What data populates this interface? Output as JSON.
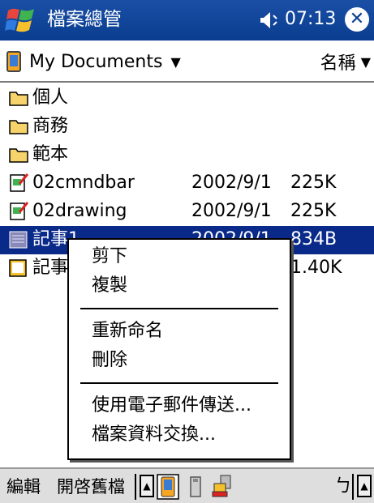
{
  "titlebar": {
    "start_icon": "windows-flag-icon",
    "title": "檔案總管",
    "speaker_icon": "speaker-icon",
    "time": "07:13",
    "close_icon": "close-icon",
    "close_glyph": "✕"
  },
  "location": {
    "folder": "My Documents",
    "sort": "名稱"
  },
  "files": [
    {
      "name": "個人",
      "type": "folder",
      "date": "",
      "size": ""
    },
    {
      "name": "商務",
      "type": "folder",
      "date": "",
      "size": ""
    },
    {
      "name": "範本",
      "type": "folder",
      "date": "",
      "size": ""
    },
    {
      "name": "02cmndbar",
      "type": "doc",
      "date": "2002/9/1",
      "size": "225K"
    },
    {
      "name": "02drawing",
      "type": "doc",
      "date": "2002/9/1",
      "size": "225K"
    },
    {
      "name": "記事1",
      "type": "note",
      "date": "2002/9/1",
      "size": "834B",
      "selected": true
    },
    {
      "name": "記事",
      "type": "note2",
      "date": "",
      "size": "1.40K"
    }
  ],
  "context_menu": {
    "items": [
      "剪下",
      "複製",
      "重新命名",
      "刪除",
      "使用電子郵件傳送...",
      "檔案資料交換..."
    ]
  },
  "toolbar": {
    "edit": "編輯",
    "open": "開啓舊檔",
    "up_glyph": "▲",
    "undo_glyph": "ㄅ"
  },
  "colors": {
    "titlebar": "#0a3d8f",
    "selection": "#0a2a8a",
    "toolbar": "#dedede"
  }
}
